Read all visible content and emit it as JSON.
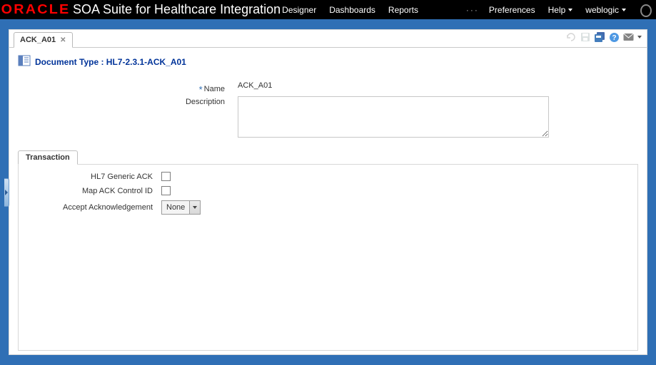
{
  "header": {
    "logo": "ORACLE",
    "app_title": "SOA Suite for Healthcare Integration",
    "nav": [
      "Designer",
      "Dashboards",
      "Reports"
    ],
    "right": {
      "preferences": "Preferences",
      "help": "Help",
      "user": "weblogic"
    }
  },
  "editor": {
    "tab_label": "ACK_A01",
    "toolbar": {
      "revert": "revert-icon",
      "save": "save-icon",
      "save2": "save-icon-2",
      "help": "help-icon",
      "mail": "mail-icon"
    }
  },
  "doc": {
    "title_prefix": "Document Type :",
    "title_value": "HL7-2.3.1-ACK_A01",
    "name_label": "Name",
    "name_value": "ACK_A01",
    "description_label": "Description",
    "description_value": ""
  },
  "transaction": {
    "tab_label": "Transaction",
    "fields": {
      "hl7_generic_ack_label": "HL7 Generic ACK",
      "hl7_generic_ack_checked": false,
      "map_ack_ctrl_id_label": "Map ACK Control ID",
      "map_ack_ctrl_id_checked": false,
      "accept_ack_label": "Accept Acknowledgement",
      "accept_ack_value": "None"
    }
  }
}
